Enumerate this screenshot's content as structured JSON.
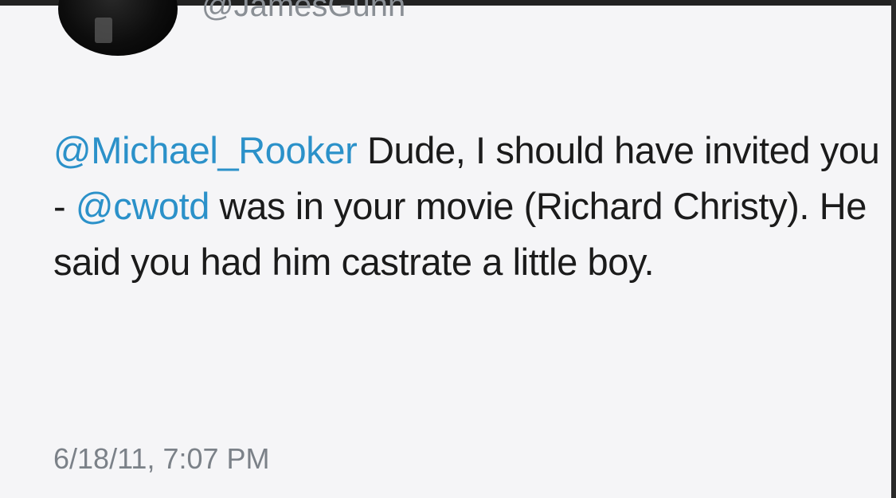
{
  "tweet": {
    "handle": "@JamesGunn",
    "segments": {
      "mention1": "@Michael_Rooker",
      "text1": " Dude, I should have invited you - ",
      "mention2": "@cwotd",
      "text2": " was in your movie (Richard Christy). He said you had him castrate a little boy."
    },
    "timestamp": "6/18/11, 7:07 PM"
  },
  "colors": {
    "mention": "#2b91c9",
    "text": "#1b1b1b",
    "meta": "#7b8188",
    "background": "#f5f5f7"
  }
}
